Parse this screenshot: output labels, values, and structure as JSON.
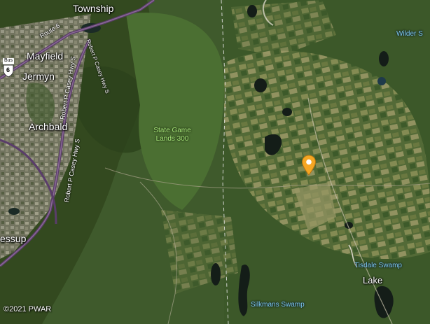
{
  "map": {
    "colors": {
      "forest_dark": "#2f4a22",
      "forest": "#44652f",
      "farmland": "#8a8f55",
      "urban": "#8d8a7c",
      "water": "#141d18",
      "highway": "#5a3d6a",
      "road": "#d8d4c6",
      "pin": "#f5a623"
    },
    "labels": {
      "township": "Township",
      "mayfield": "Mayfield",
      "jermyn": "Jermyn",
      "archbald": "Archbald",
      "jessup": "essup",
      "state_game_lands": "State Game\nLands 300",
      "wilder": "Wilder S",
      "tisdale_swamp": "Tisdale Swamp",
      "lake": "Lake",
      "silkmans_swamp": "Silkmans Swamp"
    },
    "roads": {
      "route6": "Route 6",
      "casey_hwy_upper": "Robert P Casey Hwy S",
      "casey_hwy_lower": "Robert P Casey Hwy S",
      "casey_hwy_top": "Robert P Casey Hwy S"
    },
    "shield": {
      "text": "Bus",
      "number": "6",
      "icon": "us-route-shield-icon"
    },
    "pin_icon": "location-pin-icon",
    "copyright": "©2021 PWAR"
  }
}
